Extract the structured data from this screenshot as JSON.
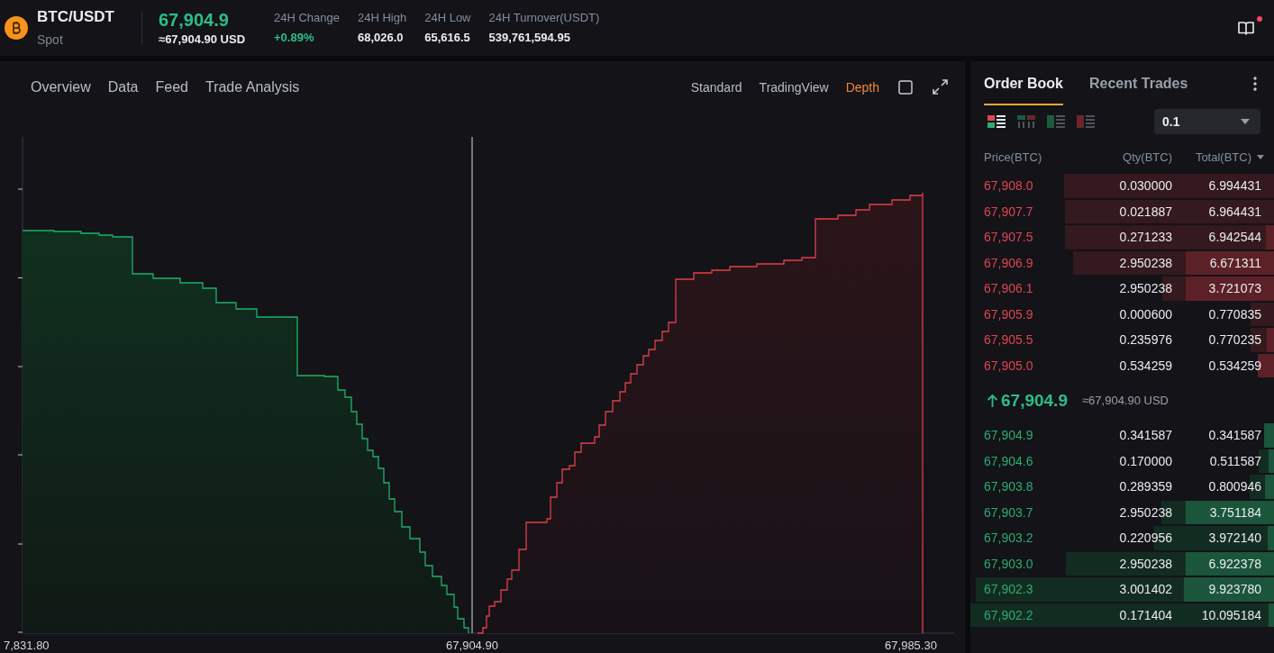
{
  "header": {
    "pair": "BTC/USDT",
    "market": "Spot",
    "last_price": "67,904.9",
    "last_price_usd": "≈67,904.90 USD",
    "stats": [
      {
        "label": "24H Change",
        "value": "+0.89%",
        "kind": "change"
      },
      {
        "label": "24H High",
        "value": "68,026.0",
        "kind": "value"
      },
      {
        "label": "24H Low",
        "value": "65,616.5",
        "kind": "value"
      },
      {
        "label": "24H Turnover(USDT)",
        "value": "539,761,594.95",
        "kind": "value"
      }
    ],
    "guide": {
      "notification": true
    }
  },
  "chart_panel": {
    "tabs": [
      "Overview",
      "Data",
      "Feed",
      "Trade Analysis"
    ],
    "views": [
      {
        "label": "Standard",
        "selected": false
      },
      {
        "label": "TradingView",
        "selected": false
      },
      {
        "label": "Depth",
        "selected": true
      }
    ],
    "depth_chart": {
      "x_labels": [
        "7,831.80",
        "67,904.90",
        "67,985.30"
      ]
    }
  },
  "order_book": {
    "tabs": [
      {
        "label": "Order Book",
        "selected": true
      },
      {
        "label": "Recent Trades",
        "selected": false
      }
    ],
    "layout_modes": [
      {
        "kind": "both",
        "selected": true
      },
      {
        "kind": "columns",
        "selected": false
      },
      {
        "kind": "bids",
        "selected": false
      },
      {
        "kind": "asks",
        "selected": false
      }
    ],
    "precision": "0.1",
    "columns": [
      "Price(BTC)",
      "Qty(BTC)",
      "Total(BTC)"
    ],
    "asks": [
      {
        "price": "67,908.0",
        "qty": "0.030000",
        "total": "6.994431"
      },
      {
        "price": "67,907.7",
        "qty": "0.021887",
        "total": "6.964431"
      },
      {
        "price": "67,907.5",
        "qty": "0.271233",
        "total": "6.942544"
      },
      {
        "price": "67,906.9",
        "qty": "2.950238",
        "total": "6.671311"
      },
      {
        "price": "67,906.1",
        "qty": "2.950238",
        "total": "3.721073"
      },
      {
        "price": "67,905.9",
        "qty": "0.000600",
        "total": "0.770835"
      },
      {
        "price": "67,905.5",
        "qty": "0.235976",
        "total": "0.770235"
      },
      {
        "price": "67,905.0",
        "qty": "0.534259",
        "total": "0.534259"
      }
    ],
    "mid_price": {
      "price": "67,904.9",
      "usd": "≈67,904.90 USD"
    },
    "bids": [
      {
        "price": "67,904.9",
        "qty": "0.341587",
        "total": "0.341587"
      },
      {
        "price": "67,904.6",
        "qty": "0.170000",
        "total": "0.511587"
      },
      {
        "price": "67,903.8",
        "qty": "0.289359",
        "total": "0.800946"
      },
      {
        "price": "67,903.7",
        "qty": "2.950238",
        "total": "3.751184"
      },
      {
        "price": "67,903.2",
        "qty": "0.220956",
        "total": "3.972140"
      },
      {
        "price": "67,903.0",
        "qty": "2.950238",
        "total": "6.922378"
      },
      {
        "price": "67,902.3",
        "qty": "3.001402",
        "total": "9.923780"
      },
      {
        "price": "67,902.2",
        "qty": "0.171404",
        "total": "10.095184"
      }
    ]
  }
}
